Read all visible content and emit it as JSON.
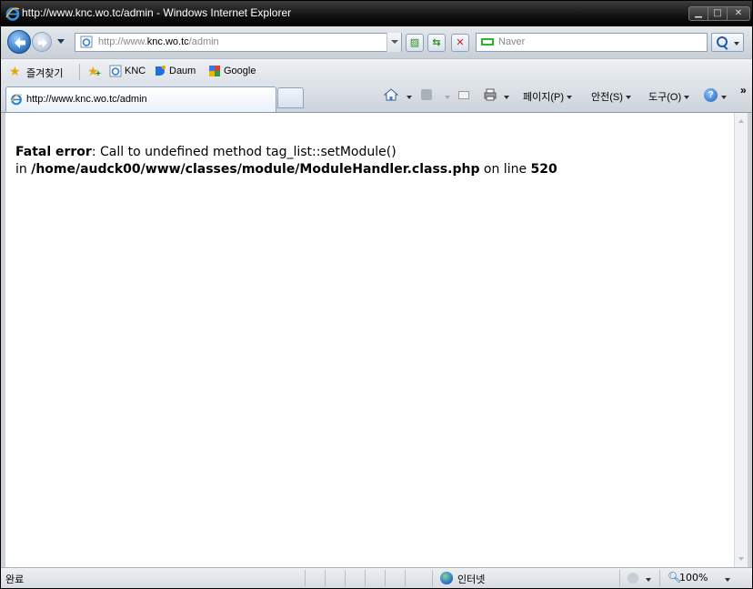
{
  "window": {
    "title": "http://www.knc.wo.tc/admin - Windows Internet Explorer",
    "controls": [
      "minimize",
      "maximize",
      "close"
    ]
  },
  "address_bar": {
    "url_prefix": "http://www.",
    "url_host": "knc.wo.tc",
    "url_path": "/admin",
    "search_placeholder": "Naver"
  },
  "favorites_bar": {
    "favorites_label": "즐겨찾기",
    "links": [
      {
        "label": "KNC",
        "icon": "ie-page-icon"
      },
      {
        "label": "Daum",
        "icon": "daum-icon"
      },
      {
        "label": "Google",
        "icon": "google-icon"
      }
    ]
  },
  "tabs": {
    "active_tab_label": "http://www.knc.wo.tc/admin"
  },
  "command_bar": {
    "page_label": "페이지(P)",
    "safety_label": "안전(S)",
    "tools_label": "도구(O)",
    "overflow": "»"
  },
  "content": {
    "error_label": "Fatal error",
    "error_message": ": Call to undefined method tag_list::setModule()",
    "error_in": "in ",
    "error_file": "/home/audck00/www/classes/module/ModuleHandler.class.php",
    "error_on_line": " on line ",
    "error_line": "520"
  },
  "status_bar": {
    "status_text": "완료",
    "zone_text": "인터넷",
    "zoom_text": "100%"
  },
  "colors": {
    "titlebar": "#111111",
    "accent": "#1d5fb3",
    "content_bg": "#ffffff"
  }
}
